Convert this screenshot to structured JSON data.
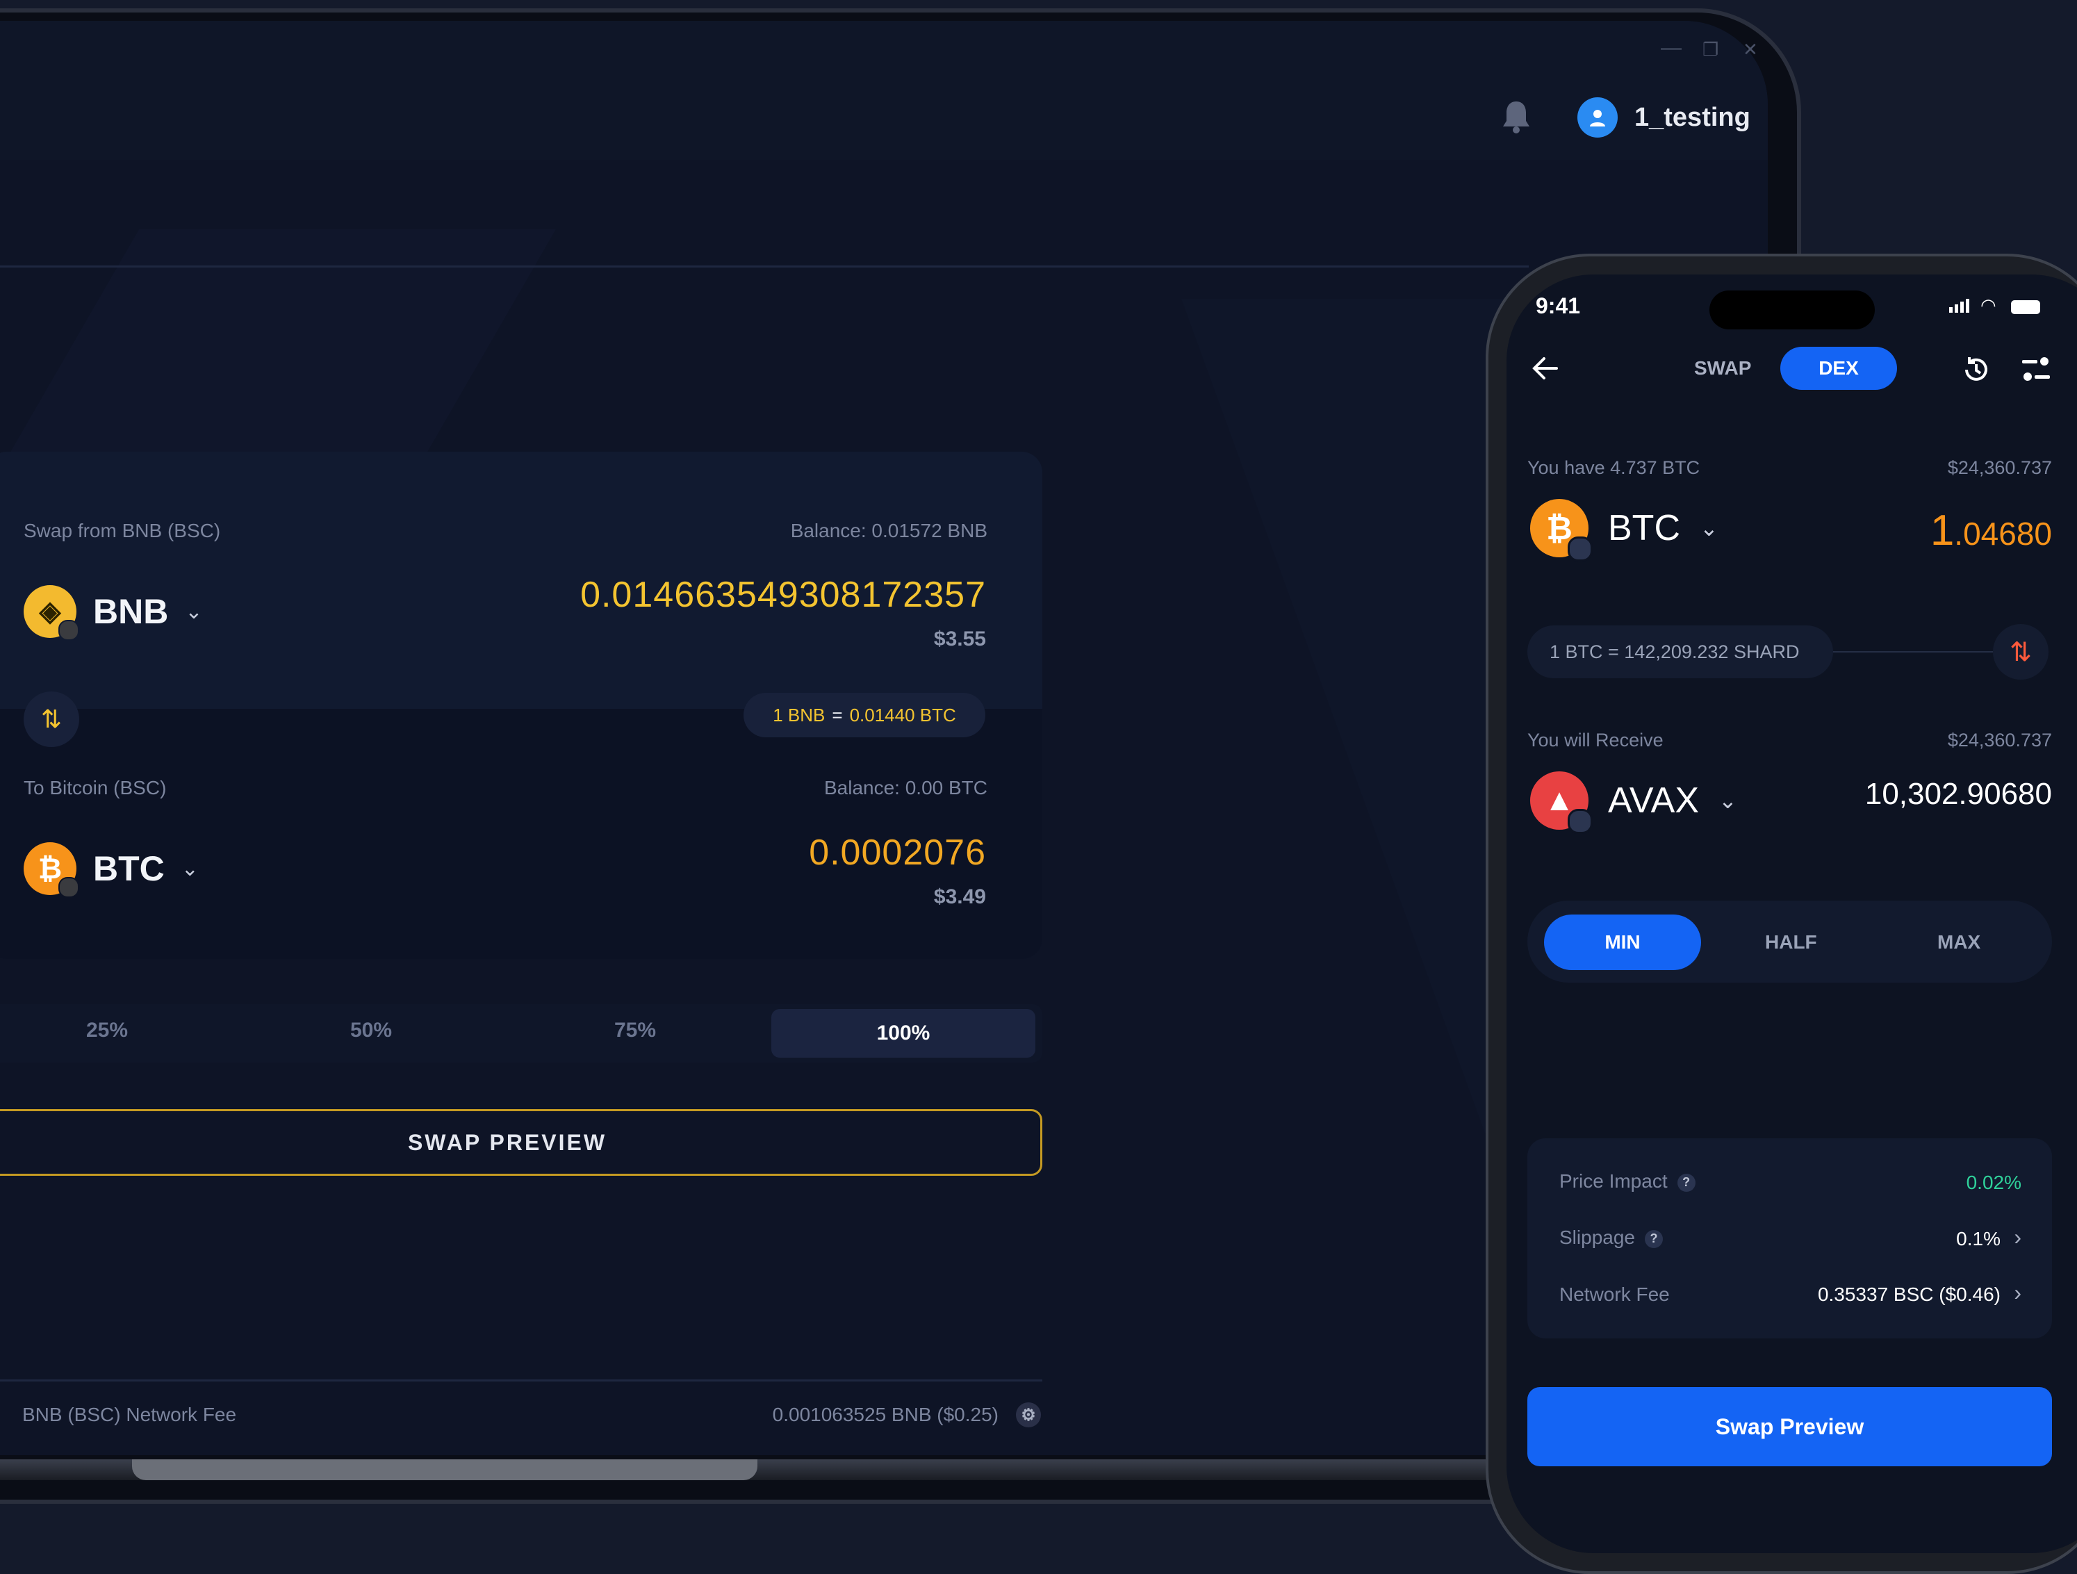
{
  "desktop": {
    "username": "1_testing",
    "from": {
      "label": "Swap from BNB (BSC)",
      "balance": "Balance: 0.01572 BNB",
      "token": "BNB",
      "amount": "0.014663549308172357",
      "usd": "$3.55"
    },
    "rate": {
      "left": "1 BNB",
      "eq": "=",
      "right": "0.01440 BTC"
    },
    "to": {
      "label": "To Bitcoin (BSC)",
      "balance": "Balance: 0.00 BTC",
      "token": "BTC",
      "amount": "0.0002076",
      "usd": "$3.49"
    },
    "percent_options": [
      "25%",
      "50%",
      "75%",
      "100%"
    ],
    "selected_percent": "100%",
    "swap_preview_label": "SWAP PREVIEW",
    "fee": {
      "label": "BNB (BSC) Network Fee",
      "value": "0.001063525 BNB ($0.25)"
    }
  },
  "mobile": {
    "time": "9:41",
    "tabs": {
      "swap": "SWAP",
      "dex": "DEX"
    },
    "from": {
      "have": "You have 4.737 BTC",
      "usd": "$24,360.737",
      "token": "BTC",
      "amount_int": "1",
      "amount_dec": ".04680"
    },
    "rate": "1 BTC  = 142,209.232 SHARD",
    "to": {
      "label": "You will Receive",
      "usd": "$24,360.737",
      "token": "AVAX",
      "amount": "10,302.90680"
    },
    "amount_options": {
      "min": "MIN",
      "half": "HALF",
      "max": "MAX"
    },
    "details": {
      "price_impact_label": "Price Impact",
      "price_impact_value": "0.02%",
      "slippage_label": "Slippage",
      "slippage_value": "0.1%",
      "network_fee_label": "Network Fee",
      "network_fee_value": "0.35337 BSC ($0.46)"
    },
    "swap_preview_label": "Swap Preview"
  },
  "colors": {
    "accent_blue": "#1464f4",
    "yellow": "#f4c430",
    "orange": "#f7931a",
    "green": "#2fd19a",
    "bg": "#0e1426"
  }
}
